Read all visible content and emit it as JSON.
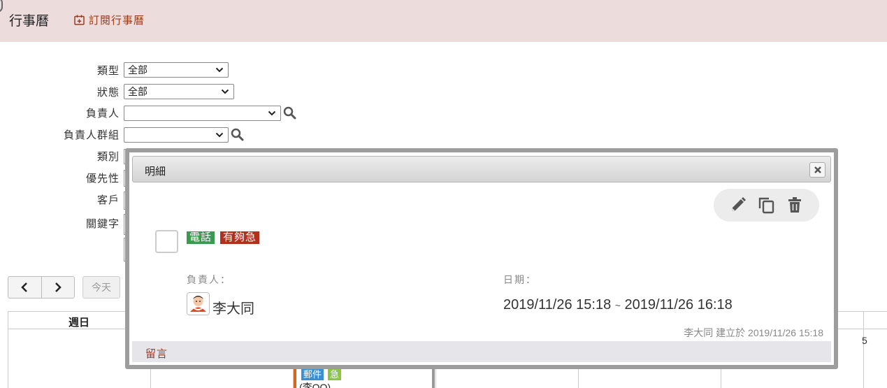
{
  "header": {
    "title": "行事曆",
    "subscribe_label": "訂閱行事曆",
    "subscribe_icon": "calendar-plus-icon",
    "accent": "#9a3b1d"
  },
  "filters": {
    "type_label": "類型",
    "type_value": "全部",
    "status_label": "狀態",
    "status_value": "全部",
    "owner_label": "負責人",
    "owner_value": "",
    "owner_group_label": "負責人群組",
    "owner_group_value": "",
    "category_label": "類別",
    "priority_label": "優先性",
    "customer_label": "客戶",
    "keyword_label": "關鍵字"
  },
  "nav": {
    "prev_icon": "chevron-left-icon",
    "next_icon": "chevron-right-icon",
    "today_label": "今天"
  },
  "calendar": {
    "day_sunday": "週日",
    "visible_day_number": "5",
    "event": {
      "tag_type": "郵件",
      "tag_priority": "急",
      "owner": "(李OO)"
    }
  },
  "dialog": {
    "title": "明細",
    "close_icon": "close-icon",
    "toolbar": [
      "edit-icon",
      "copy-icon",
      "delete-icon"
    ],
    "tags": {
      "type": "電話",
      "priority": "有夠急"
    },
    "owner_label": "負責人：",
    "owner_name": "李大同",
    "date_label": "日期：",
    "start": "2019/11/26 15:18",
    "separator": "~",
    "end": "2019/11/26 16:18",
    "created_note": "李大同 建立於 2019/11/26 15:18",
    "comments_label": "留言"
  }
}
